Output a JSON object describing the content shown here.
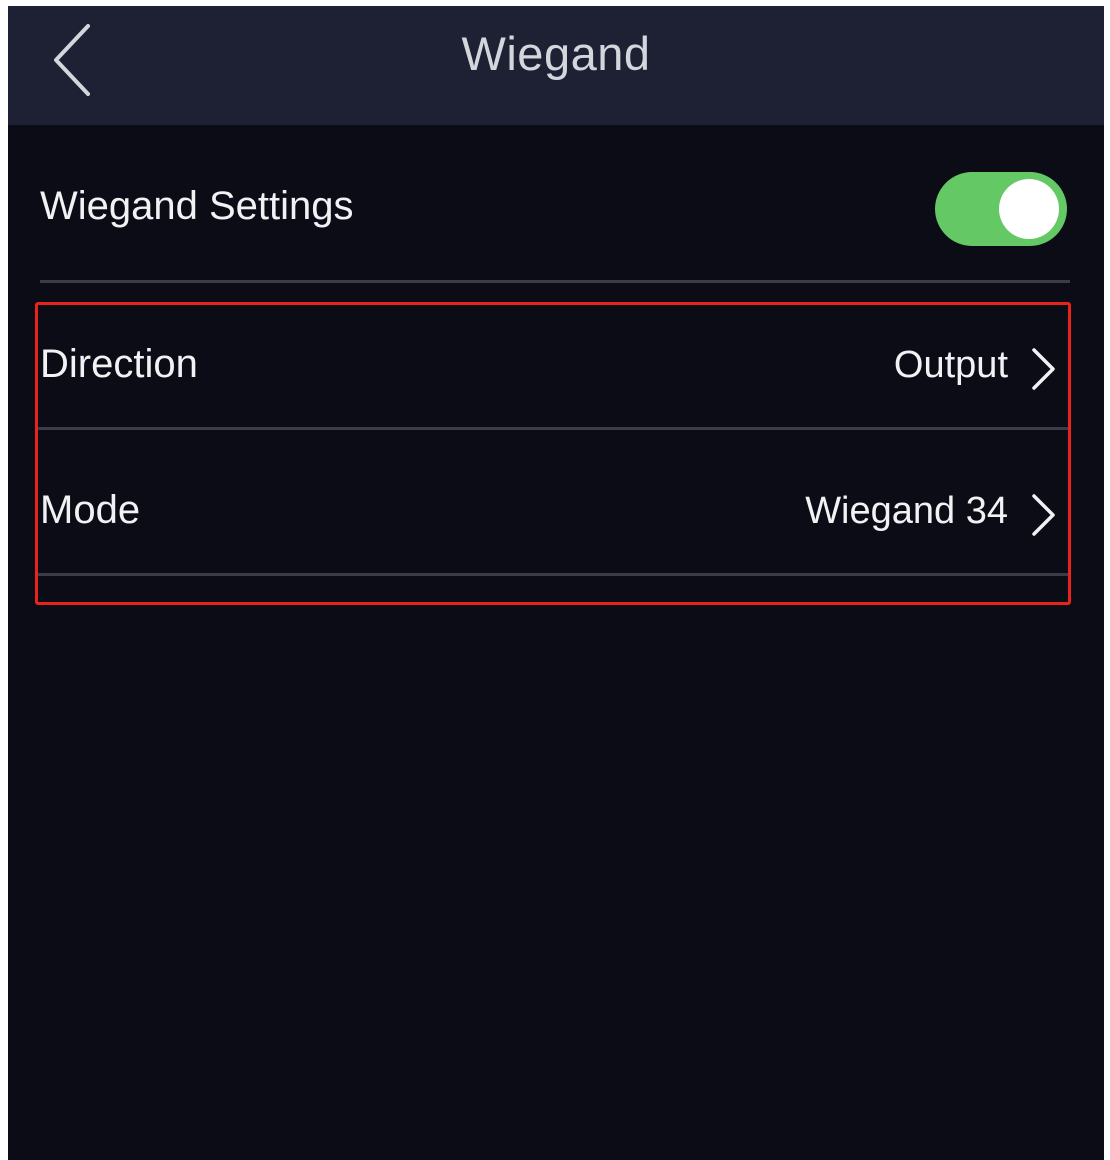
{
  "header": {
    "title": "Wiegand",
    "back_icon": "chevron-left-icon"
  },
  "settings": {
    "label": "Wiegand Settings",
    "enabled": true,
    "toggle_color": "#64c864"
  },
  "rows": [
    {
      "label": "Direction",
      "value": "Output",
      "icon": "chevron-right-icon"
    },
    {
      "label": "Mode",
      "value": "Wiegand 34",
      "icon": "chevron-right-icon"
    }
  ],
  "highlight_color": "#e8231d"
}
